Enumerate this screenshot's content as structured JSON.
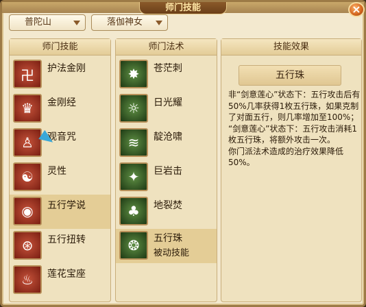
{
  "window": {
    "title": "师门技能",
    "close_icon": "close-icon"
  },
  "dropdowns": [
    {
      "value": "普陀山"
    },
    {
      "value": "落伽神女"
    }
  ],
  "skills_panel": {
    "header": "师门技能",
    "items": [
      {
        "label": "护法金刚",
        "icon": "vajra-guardian-icon"
      },
      {
        "label": "金刚经",
        "icon": "diamond-sutra-icon"
      },
      {
        "label": "观音咒",
        "icon": "guanyin-mantra-icon"
      },
      {
        "label": "灵性",
        "icon": "spirit-icon"
      },
      {
        "label": "五行学说",
        "icon": "five-elements-theory-icon",
        "selected": true
      },
      {
        "label": "五行扭转",
        "icon": "five-elements-twist-icon"
      },
      {
        "label": "莲花宝座",
        "icon": "lotus-throne-icon"
      }
    ]
  },
  "spells_panel": {
    "header": "师门法术",
    "items": [
      {
        "label": "苍茫刺",
        "icon": "vast-thorn-icon"
      },
      {
        "label": "日光耀",
        "icon": "sunlight-icon"
      },
      {
        "label": "靛沧啸",
        "icon": "indigo-roar-icon"
      },
      {
        "label": "巨岩击",
        "icon": "boulder-strike-icon"
      },
      {
        "label": "地裂焚",
        "icon": "earth-burn-icon"
      },
      {
        "label": "五行珠",
        "sublabel": "被动技能",
        "icon": "five-elements-orb-icon",
        "selected": true
      }
    ]
  },
  "effect_panel": {
    "header": "技能效果",
    "title": "五行珠",
    "lines": [
      "非“剑意莲心”状态下：五行攻击后有50%几率获得1枚五行珠，如果克制了对面五行，则几率增加至100%；",
      "“剑意莲心”状态下：五行攻击消耗1枚五行珠，将额外攻击一次。",
      "你门派法术造成的治疗效果降低50%。"
    ]
  }
}
